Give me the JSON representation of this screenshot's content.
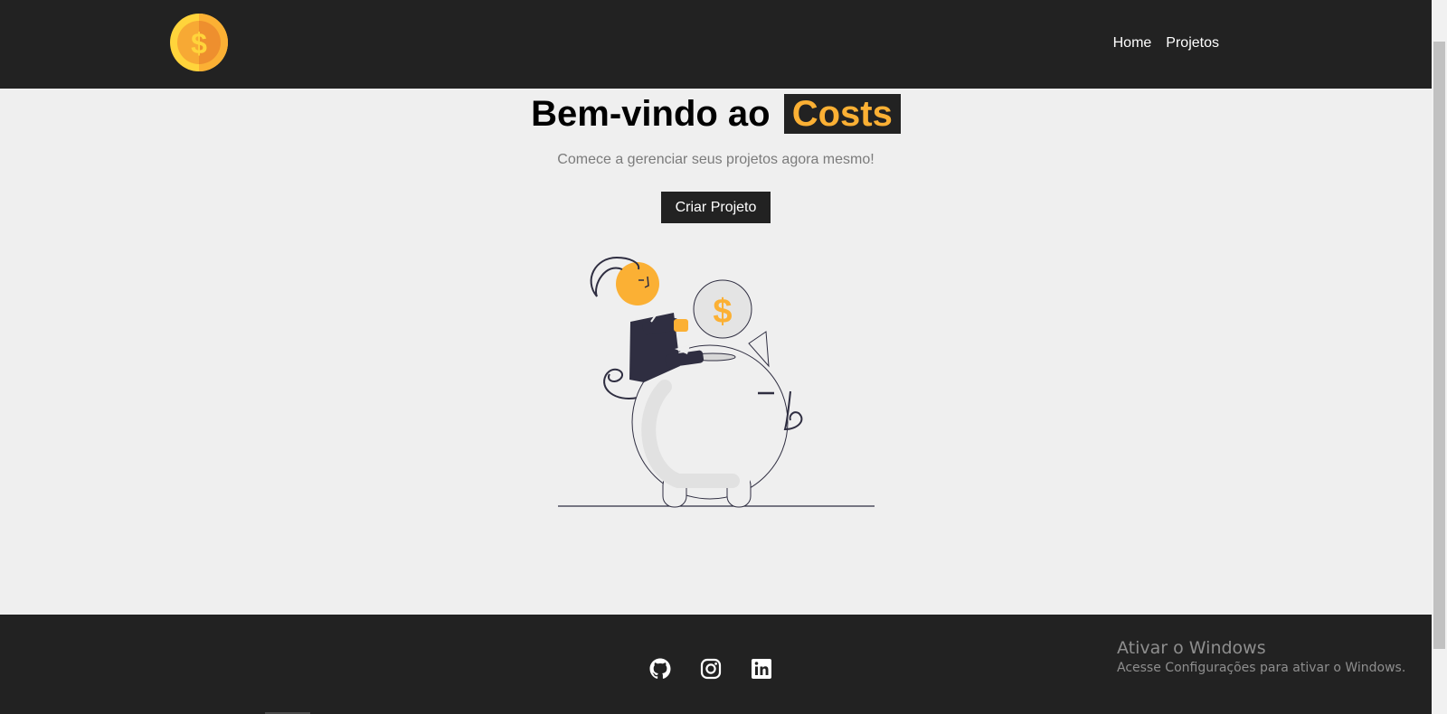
{
  "navbar": {
    "logo_icon": "dollar-coin-icon",
    "links": [
      {
        "label": "Home"
      },
      {
        "label": "Projetos"
      }
    ]
  },
  "hero": {
    "title_prefix": "Bem-vindo ao",
    "title_brand": "Costs",
    "subtitle": "Comece a gerenciar seus projetos agora mesmo!",
    "cta_label": "Criar Projeto",
    "illustration": "savings-piggy-bank-illustration"
  },
  "footer": {
    "social": [
      {
        "icon": "github-icon"
      },
      {
        "icon": "instagram-icon"
      },
      {
        "icon": "linkedin-icon"
      }
    ]
  },
  "watermark": {
    "title": "Ativar o Windows",
    "subtitle": "Acesse Configurações para ativar o Windows."
  },
  "colors": {
    "dark": "#222222",
    "accent": "#fbb034",
    "background": "#efefef",
    "muted_text": "#7b7b7b"
  }
}
